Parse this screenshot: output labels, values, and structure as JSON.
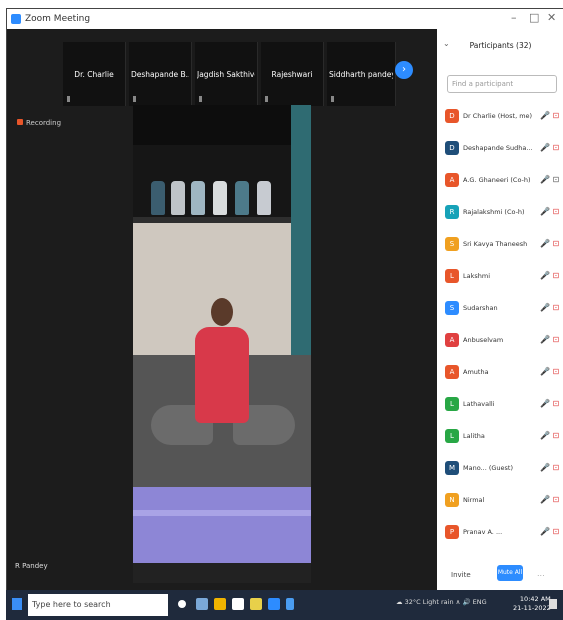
{
  "window": {
    "title": "Zoom Meeting",
    "minimize": "–",
    "maximize": "□",
    "close": "✕"
  },
  "thumbnails": [
    {
      "name": "Dr. Charlie"
    },
    {
      "name": "Deshapande B..."
    },
    {
      "name": "Jagdish Sakthivel"
    },
    {
      "name": "Rajeshwari"
    },
    {
      "name": "Siddharth pandey"
    }
  ],
  "next_arrow": "›",
  "recording_label": "Recording",
  "self_view_name": "R Pandey",
  "participants_panel": {
    "title": "Participants (32)",
    "collapse": "⌄",
    "search_placeholder": "Find a participant",
    "participants": [
      {
        "initial": "D",
        "name": "Dr Charlie (Host, me)",
        "color": "#e8562a",
        "icons": "🎤 ⊡",
        "muted": true
      },
      {
        "initial": "D",
        "name": "Deshapande Sudha... (Co-h)",
        "color": "#1f4e79",
        "icons": "🎤 ⊡",
        "muted": true
      },
      {
        "initial": "A",
        "name": "A.G. Ghaneeri (Co-h)",
        "color": "#e8562a",
        "icons": "🎤 ⊡",
        "muted": false
      },
      {
        "initial": "R",
        "name": "Rajalakshmi (Co-h)",
        "color": "#17a2b8",
        "icons": "🎤 ⊡",
        "muted": true
      },
      {
        "initial": "S",
        "name": "Sri Kavya Thaneesh",
        "color": "#f0a020",
        "icons": "🎤 ⊡",
        "muted": true
      },
      {
        "initial": "L",
        "name": "Lakshmi",
        "color": "#e8562a",
        "icons": "🎤 ⊡",
        "muted": true
      },
      {
        "initial": "S",
        "name": "Sudarshan",
        "color": "#2d8cff",
        "icons": "🎤 ⊡",
        "muted": true
      },
      {
        "initial": "A",
        "name": "Anbuselvam",
        "color": "#e04040",
        "icons": "🎤 ⊡",
        "muted": true
      },
      {
        "initial": "A",
        "name": "Amutha",
        "color": "#e8562a",
        "icons": "🎤 ⊡",
        "muted": true
      },
      {
        "initial": "L",
        "name": "Lathavalli",
        "color": "#28a745",
        "icons": "🎤 ⊡",
        "muted": true
      },
      {
        "initial": "L",
        "name": "Lalitha",
        "color": "#28a745",
        "icons": "🎤 ⊡",
        "muted": true
      },
      {
        "initial": "M",
        "name": "Mano... (Guest)",
        "color": "#1f4e79",
        "icons": "🎤 ⊡",
        "muted": true
      },
      {
        "initial": "N",
        "name": "Nirmal",
        "color": "#f0a020",
        "icons": "🎤 ⊡",
        "muted": true
      },
      {
        "initial": "P",
        "name": "Pranav A. ...",
        "color": "#e8562a",
        "icons": "🎤 ⊡",
        "muted": true
      }
    ],
    "invite_label": "Invite",
    "mute_all_label": "Mute All",
    "more_label": "..."
  },
  "taskbar": {
    "search_placeholder": "Type here to search",
    "tray_text": "☁ 32°C  Light rain  ∧ 🔊 ENG",
    "time": "10:42 AM",
    "date": "21-11-2022"
  }
}
